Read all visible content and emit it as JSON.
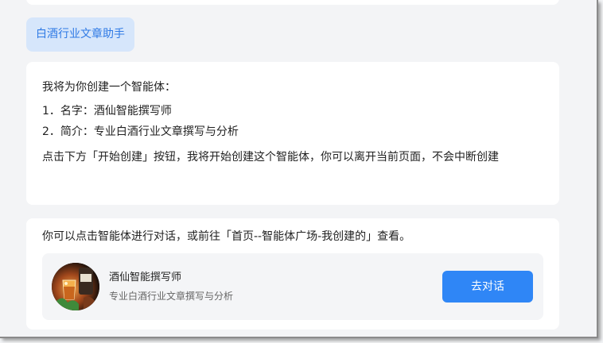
{
  "user_message": "白酒行业文章助手",
  "reply": {
    "intro": "我将为你创建一个智能体：",
    "items": [
      "1．名字：酒仙智能撰写师",
      "2．简介：专业白酒行业文章撰写与分析"
    ],
    "note": "点击下方「开始创建」按钮，我将开始创建这个智能体，你可以离开当前页面，不会中断创建"
  },
  "result": {
    "hint": "你可以点击智能体进行对话，或前往「首页--智能体广场-我创建的」查看。",
    "agent": {
      "name": "酒仙智能撰写师",
      "description": "专业白酒行业文章撰写与分析",
      "avatar_icon": "whisky-glass-avatar"
    },
    "chat_button_label": "去对话"
  },
  "colors": {
    "page_bg": "#f3f4f6",
    "bubble_bg": "#d6e6fb",
    "bubble_text": "#2f7ae5",
    "accent_button": "#2f86f6"
  }
}
